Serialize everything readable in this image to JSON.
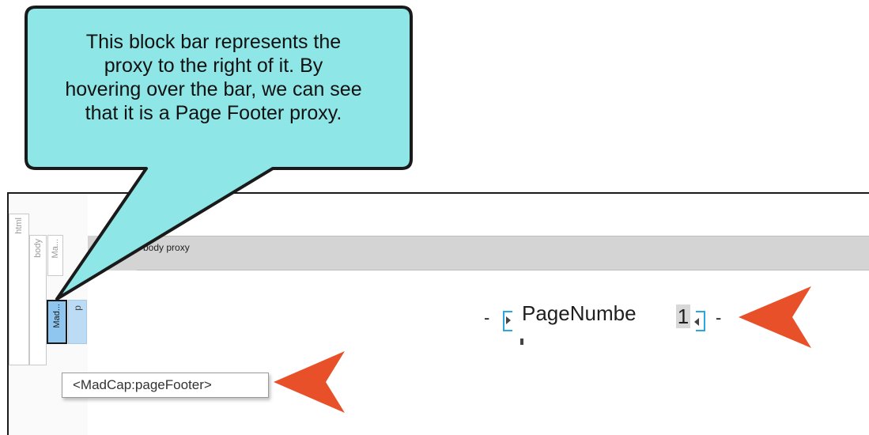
{
  "callout": {
    "lines": [
      "This block bar represents the",
      "proxy to the right of it. By",
      "hovering over the bar, we can see",
      "that it is a Page Footer proxy."
    ],
    "fill_color": "#8ee6e6",
    "border_color": "#1a1a1a"
  },
  "structure_bars": {
    "html": "html",
    "body": "body",
    "ma": "Ma...",
    "madcap": "Mad...",
    "p": "p"
  },
  "body_proxy": {
    "label": "body proxy"
  },
  "page_number": {
    "dash_left": "-",
    "text": "PageNumbe",
    "value": "1",
    "dash_right": "-"
  },
  "tooltip": {
    "text": "<MadCap:pageFooter>"
  },
  "colors": {
    "arrow": "#e8502a",
    "proxy_bracket": "#2aa7e0",
    "block_bar_selected": "#8ec6ef",
    "block_bar_p": "#bcdcf5",
    "proxy_band": "#d4d4d4"
  }
}
